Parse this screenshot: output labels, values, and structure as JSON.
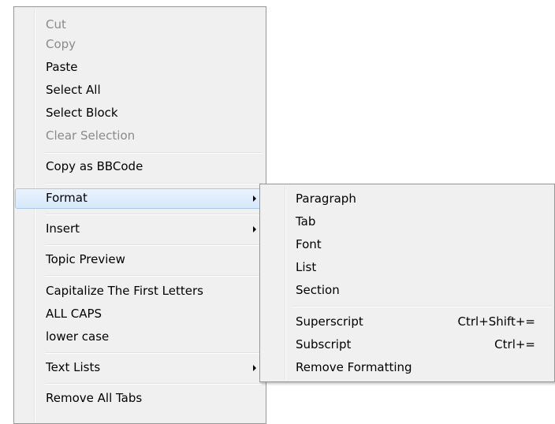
{
  "main_menu": {
    "items": [
      {
        "label": "Cut",
        "disabled": true
      },
      {
        "label": "Copy",
        "disabled": true
      },
      {
        "label": "Paste"
      },
      {
        "label": "Select All"
      },
      {
        "label": "Select Block"
      },
      {
        "label": "Clear Selection",
        "disabled": true
      },
      {
        "label": "Copy as BBCode"
      },
      {
        "label": "Format",
        "submenu": true,
        "highlighted": true
      },
      {
        "label": "Insert",
        "submenu": true
      },
      {
        "label": "Topic Preview"
      },
      {
        "label": "Capitalize The First Letters"
      },
      {
        "label": "ALL CAPS"
      },
      {
        "label": "lower case"
      },
      {
        "label": "Text Lists",
        "submenu": true
      },
      {
        "label": "Remove All Tabs"
      }
    ]
  },
  "format_submenu": {
    "items": [
      {
        "label": "Paragraph"
      },
      {
        "label": "Tab"
      },
      {
        "label": "Font"
      },
      {
        "label": "List"
      },
      {
        "label": "Section"
      },
      {
        "label": "Superscript",
        "shortcut": "Ctrl+Shift+="
      },
      {
        "label": "Subscript",
        "shortcut": "Ctrl+="
      },
      {
        "label": "Remove Formatting"
      }
    ]
  },
  "colors": {
    "menu_background": "#f0f0f0",
    "menu_border": "#979797",
    "disabled_text": "#8a8a8a",
    "highlight_border": "#a8c9ee",
    "highlight_fill": "#d6e8fb"
  }
}
